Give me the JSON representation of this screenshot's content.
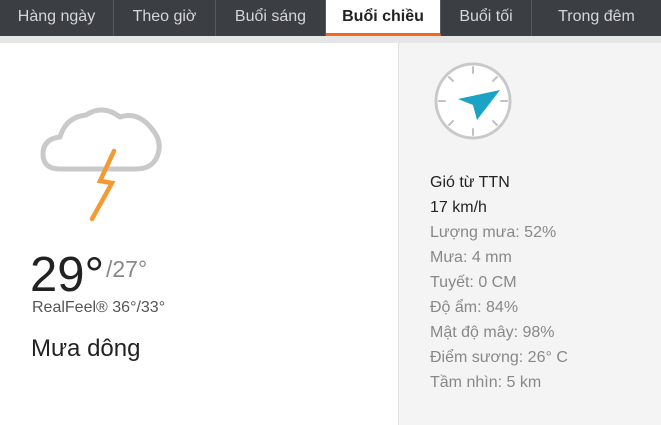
{
  "tabs": [
    {
      "label": "Hàng ngày"
    },
    {
      "label": "Theo giờ"
    },
    {
      "label": "Buổi sáng"
    },
    {
      "label": "Buổi chiều"
    },
    {
      "label": "Buổi tối"
    },
    {
      "label": "Trong đêm"
    }
  ],
  "active_tab": "Buổi chiều",
  "forecast": {
    "icon": "thunderstorm-icon",
    "temp_high": "29°",
    "temp_low": "/27°",
    "realfeel": "RealFeel® 36°/33°",
    "condition": "Mưa dông"
  },
  "details": {
    "compass_icon": "wind-direction-compass-icon",
    "wind_direction": "Gió từ TTN",
    "wind_speed": "17 km/h",
    "rain_probability": "Lượng mưa: 52%",
    "rain": "Mưa: 4 mm",
    "snow": "Tuyết: 0 CM",
    "humidity": "Độ ẩm: 84%",
    "cloud_cover": "Mật độ mây: 98%",
    "dew_point": "Điểm sương: 26° C",
    "visibility": "Tầm nhìn: 5 km"
  },
  "colors": {
    "tabbar_bg": "#3b3f44",
    "active_underline": "#f26a21",
    "compass_arrow": "#1aa3c4",
    "lightning": "#f39a32"
  }
}
